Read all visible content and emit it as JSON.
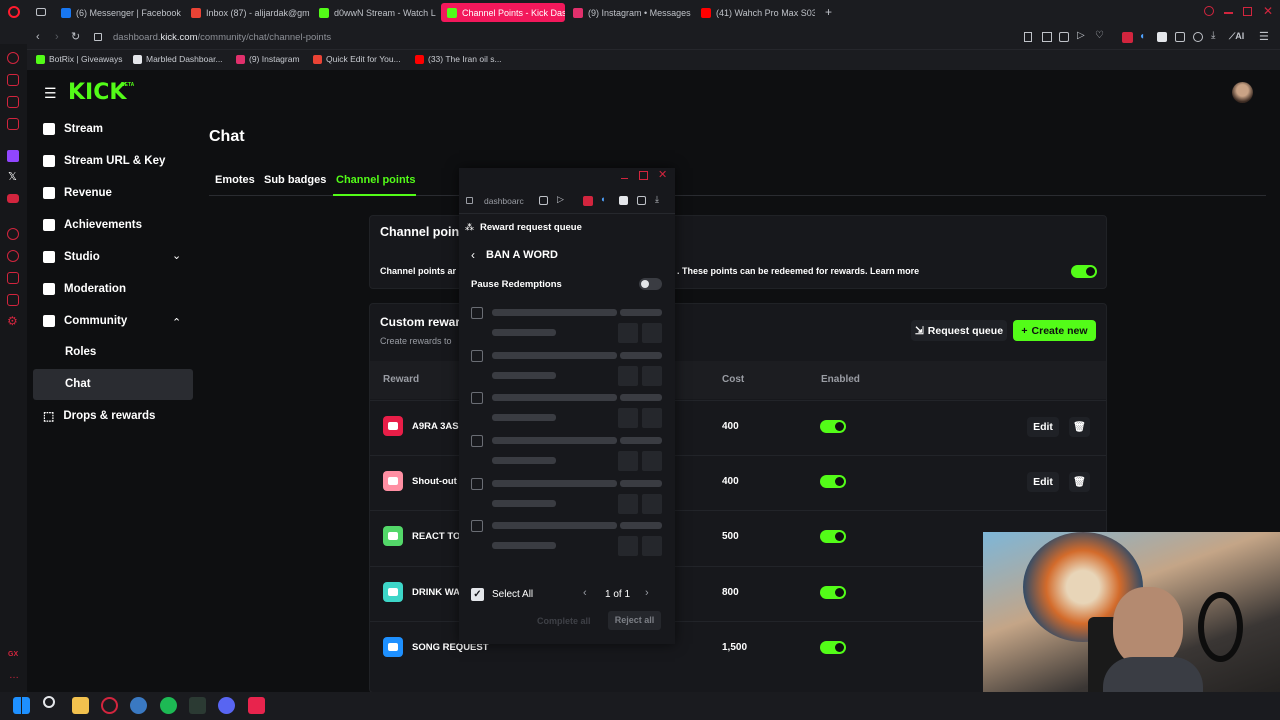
{
  "browser": {
    "tabs": [
      {
        "label": "(6) Messenger | Facebook",
        "color": "#1877f2"
      },
      {
        "label": "Inbox (87) - alijardak@gm",
        "color": "#ea4335"
      },
      {
        "label": "d0wwN Stream - Watch L",
        "color": "#53fc18"
      },
      {
        "label": "Channel Points - Kick Das",
        "color": "#53fc18",
        "active": true
      },
      {
        "label": "(9) Instagram • Messages",
        "color": "#e1306c"
      },
      {
        "label": "(41) Wahch Pro Max S03 E",
        "color": "#ff0000"
      }
    ],
    "url_domain": "dashboard.",
    "url_host": "kick.com",
    "url_path": "/community/chat/channel-points",
    "bookmarks": [
      "BotRix | Giveaways",
      "Marbled Dashboar...",
      "(9) Instagram",
      "Quick Edit for You...",
      "(33) The Iran oil s..."
    ]
  },
  "kick": {
    "logo": "KICK",
    "logo_badge": "BETA",
    "sidebar": [
      {
        "label": "Stream",
        "icon": "broadcast-icon"
      },
      {
        "label": "Stream URL & Key",
        "icon": "link-icon"
      },
      {
        "label": "Revenue",
        "icon": "chart-icon"
      },
      {
        "label": "Achievements",
        "icon": "trophy-icon"
      },
      {
        "label": "Studio",
        "icon": "studio-icon"
      },
      {
        "label": "Moderation",
        "icon": "wrench-icon"
      },
      {
        "label": "Community",
        "icon": "users-icon"
      }
    ],
    "community_sub": [
      "Roles",
      "Chat"
    ],
    "drops": "Drops & rewards",
    "page_title": "Chat",
    "tabs": [
      "Emotes",
      "Sub badges",
      "Channel points"
    ],
    "cp_card_title": "Channel point",
    "cp_card_desc_left": "Channel points ar",
    "cp_card_desc_right": ". These points can be redeemed for rewards. Learn more",
    "custom_title": "Custom rewar",
    "custom_desc": "Create rewards to",
    "request_queue": "Request queue",
    "create_new": "Create new",
    "col_reward": "Reward",
    "col_cost": "Cost",
    "col_enabled": "Enabled",
    "rewards": [
      {
        "name": "A9RA 3AS",
        "cost": "400",
        "color": "#e91e48",
        "edit": "Edit"
      },
      {
        "name": "Shout-out",
        "cost": "400",
        "color": "#ff8fa3",
        "edit": "Edit"
      },
      {
        "name": "REACT TO",
        "cost": "500",
        "color": "#53d769"
      },
      {
        "name": "DRINK WA",
        "cost": "800",
        "color": "#3dd6c8"
      },
      {
        "name": "SONG REQUEST",
        "cost": "1,500",
        "color": "#1e90ff"
      }
    ]
  },
  "popup": {
    "url": "dashboarc",
    "header": "Reward request queue",
    "title": "BAN A WORD",
    "pause": "Pause Redemptions",
    "select_all": "Select All",
    "pagination": "1 of 1",
    "complete_all": "Complete all",
    "reject_all": "Reject all"
  }
}
